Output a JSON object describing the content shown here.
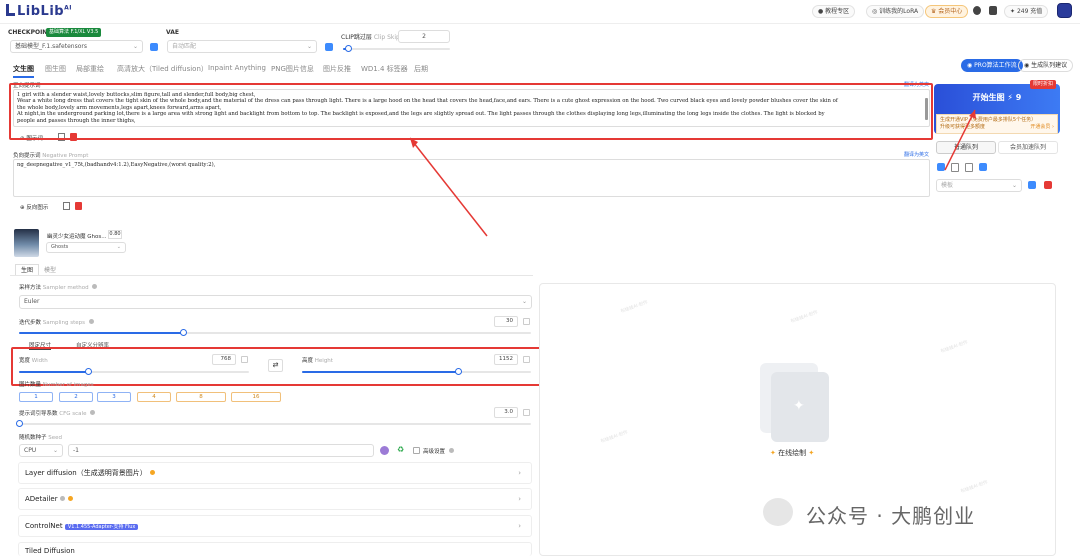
{
  "app": {
    "logo": "LibLib",
    "logo_sup": "AI"
  },
  "header": {
    "tutorial": "教程专区",
    "train_lora": "训练我的LoRA",
    "member": "会员中心",
    "points": "249 充值"
  },
  "checkpoint": {
    "label": "CHECKPOINT",
    "badge": "基础算法 F.1/XL V3.5",
    "value": "基础模型_F.1.safetensors"
  },
  "vae": {
    "label": "VAE",
    "value": "自动匹配"
  },
  "clip": {
    "label": "CLIP跳过层",
    "label_en": "Clip Skip",
    "value": "2",
    "fraction": 0.05
  },
  "tabs": [
    "文生图",
    "图生图",
    "局部重绘",
    "高清放大（Tiled diffusion）",
    "Inpaint Anything",
    "PNG图片信息",
    "图片反推",
    "WD1.4 标签器",
    "后期"
  ],
  "prompt": {
    "label": "正向提示词",
    "right_link": "翻译为英文",
    "lines": [
      "1 girl with a slender waist,lovely buttocks,slim figure,tall and slender,full body,big chest,",
      "Wear a white long dress that covers the tight skin of the whole body,and the material of the dress can pass through light. There is a large hood on the head that covers the head,face,and ears. There is a cute ghost expression on the hood. Two curved black eyes and lovely powder blushes cover the skin of",
      "the whole body,lovely arm movements,legs apart,knees forward,arms apart,",
      "At night,in the underground parking lot,there is a large area with strong light and backlight from bottom to top. The backlight is exposed,and the legs are slightly spread out. The light passes through the clothes displaying long legs,illuminating the long legs inside the clothes. The light is blocked by",
      "people and passes through the inner thighs,"
    ],
    "tool_label": "图示词"
  },
  "negative": {
    "label": "负向提示词",
    "label_en": "Negative Prompt",
    "right_link": "翻译为英文",
    "text": "ng_deepnegative_v1_75t,(badhandv4:1.2),EasyNegative,(worst quality:2),",
    "tool_label": "反向图示"
  },
  "lora": {
    "name": "幽灵少女运动魔 Ghos...",
    "weight": "0.80",
    "tag": "Ghosts"
  },
  "subtabs": [
    "生图",
    "模型"
  ],
  "sampler": {
    "label": "采样方法",
    "label_en": "Sampler method",
    "value": "Euler"
  },
  "steps": {
    "label": "迭代步数",
    "label_en": "Sampling steps",
    "value": "30",
    "fraction": 0.32
  },
  "size_tabs": [
    "固定尺寸",
    "自定义分辨率"
  ],
  "width": {
    "label": "宽度",
    "label_en": "Width",
    "value": "768",
    "fraction": 0.3
  },
  "height": {
    "label": "高度",
    "label_en": "Height",
    "value": "1152",
    "fraction": 0.68
  },
  "batch": {
    "label": "图片数量",
    "label_en": "Number of images",
    "options": [
      "1",
      "2",
      "3",
      "4",
      "8",
      "16"
    ]
  },
  "cfg": {
    "label": "提示词引导系数",
    "label_en": "CFG scale",
    "value": "3.0",
    "fraction": 0.0
  },
  "seed": {
    "label": "随机数种子",
    "label_en": "Seed",
    "device": "CPU",
    "value": "-1",
    "extra": "高级设置"
  },
  "accordions": [
    {
      "title": "Layer diffusion（生成透明背景图片）"
    },
    {
      "title": "ADetailer"
    },
    {
      "title": "ControlNet",
      "badge": "V1.1.455-Adapter-支持 Flux"
    },
    {
      "title": "Tiled Diffusion"
    }
  ],
  "right_panel": {
    "pro_btn": "PRO算法工作流",
    "queue_btn": "生成队列建议",
    "generate": "开始生图",
    "generate_cost": "9",
    "limited": "限时折扣",
    "vip_line1": "生成开通VIP（免费用户最多排队5个任务）",
    "vip_line2": "升级可获得更多额度",
    "vip_link": "开通会员 ›",
    "queue_tab1": "普通队列",
    "queue_tab2": "会员加速队列",
    "dropdown": "模板"
  },
  "canvas": {
    "online_label": "在线绘制"
  },
  "watermark": "公众号 · 大鹏创业",
  "colors": {
    "accent": "#2a6be6",
    "red_highlight": "#e53935",
    "brand": "#2b3a8f"
  }
}
